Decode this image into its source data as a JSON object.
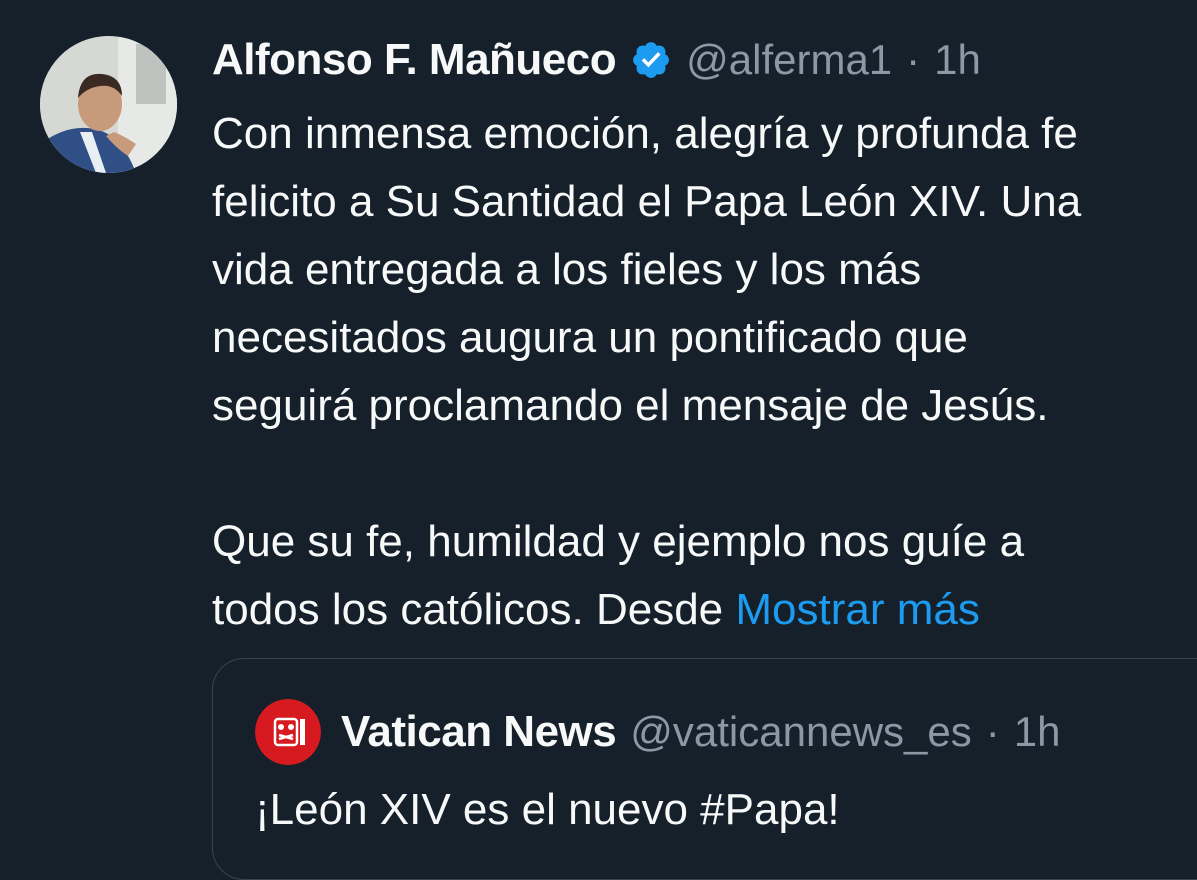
{
  "colors": {
    "background": "#15202b",
    "text_primary": "#f7f9f9",
    "text_secondary": "#8b98a5",
    "link": "#1d9bf0",
    "verified_badge": "#1d9bf0",
    "vatican_red": "#d71920"
  },
  "tweet": {
    "display_name": "Alfonso F. Mañueco",
    "verified_icon": "verified-badge-icon",
    "handle": "@alferma1",
    "separator": "·",
    "time": "1h",
    "lines": [
      "Con inmensa emoción, alegría y profunda fe",
      "felicito a Su Santidad el Papa León XIV. Una",
      "vida entregada a los fieles y los más",
      "necesitados augura un pontificado que",
      "seguirá proclamando el mensaje de Jesús."
    ],
    "lines2": [
      "Que su fe, humildad y ejemplo nos guíe a",
      "todos los católicos. Desde "
    ],
    "show_more": "Mostrar más"
  },
  "quoted": {
    "display_name": "Vatican News",
    "handle": "@vaticannews_es",
    "separator": "·",
    "time": "1h",
    "text": "¡León XIV es el nuevo #Papa!",
    "logo_icon": "vatican-news-logo-icon"
  }
}
